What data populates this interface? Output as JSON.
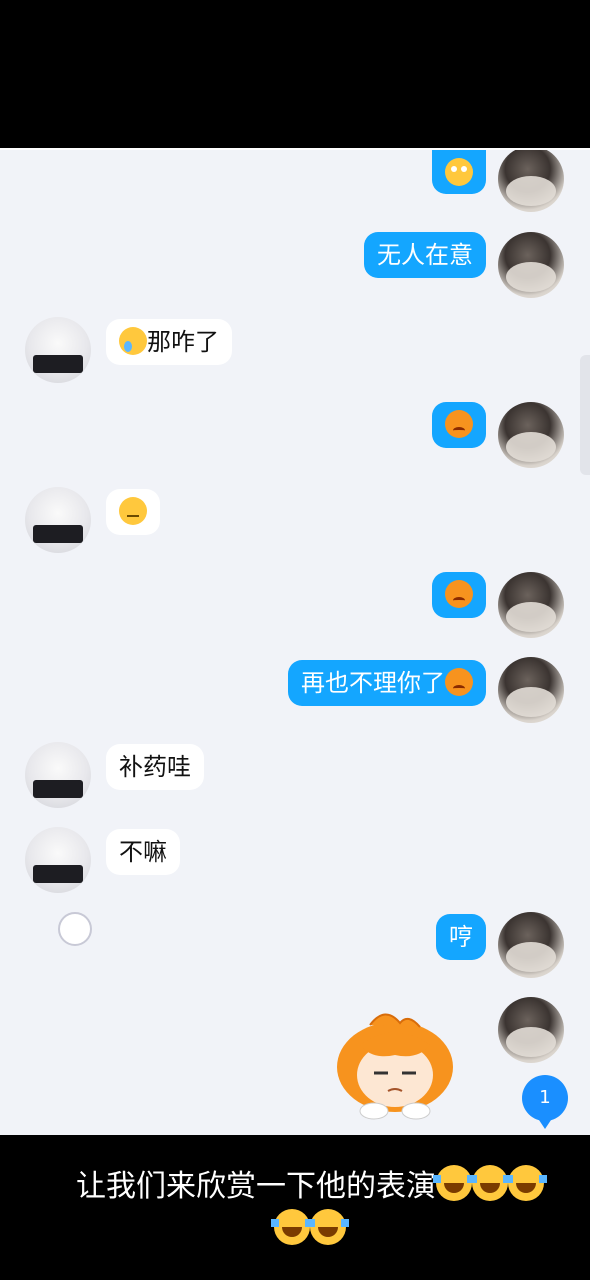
{
  "messages": [
    {
      "side": "me",
      "text": "",
      "emoji": "eyeroll"
    },
    {
      "side": "me",
      "text": "无人在意",
      "emoji": ""
    },
    {
      "side": "other",
      "text": "那咋了",
      "emoji": "sad"
    },
    {
      "side": "me",
      "text": "",
      "emoji": "angry"
    },
    {
      "side": "other",
      "text": "",
      "emoji": "neutral"
    },
    {
      "side": "me",
      "text": "",
      "emoji": "angry"
    },
    {
      "side": "me",
      "text": "再也不理你了",
      "emoji": "angry"
    },
    {
      "side": "other",
      "text": "补药哇",
      "emoji": ""
    },
    {
      "side": "other",
      "text": "不嘛",
      "emoji": ""
    },
    {
      "side": "me",
      "text": "哼",
      "emoji": ""
    },
    {
      "side": "me",
      "text": "",
      "emoji": "sticker-sulking-girl"
    }
  ],
  "unread_badge": "1",
  "caption": {
    "text": "让我们来欣赏一下他的表演",
    "emojis": [
      "laugh-cry",
      "laugh-cry",
      "laugh-cry",
      "laugh-cry",
      "laugh-cry"
    ]
  },
  "colors": {
    "my_bubble": "#14a6ff",
    "other_bubble": "#ffffff",
    "chat_bg": "#f1f3f8",
    "badge": "#1a8fff"
  }
}
